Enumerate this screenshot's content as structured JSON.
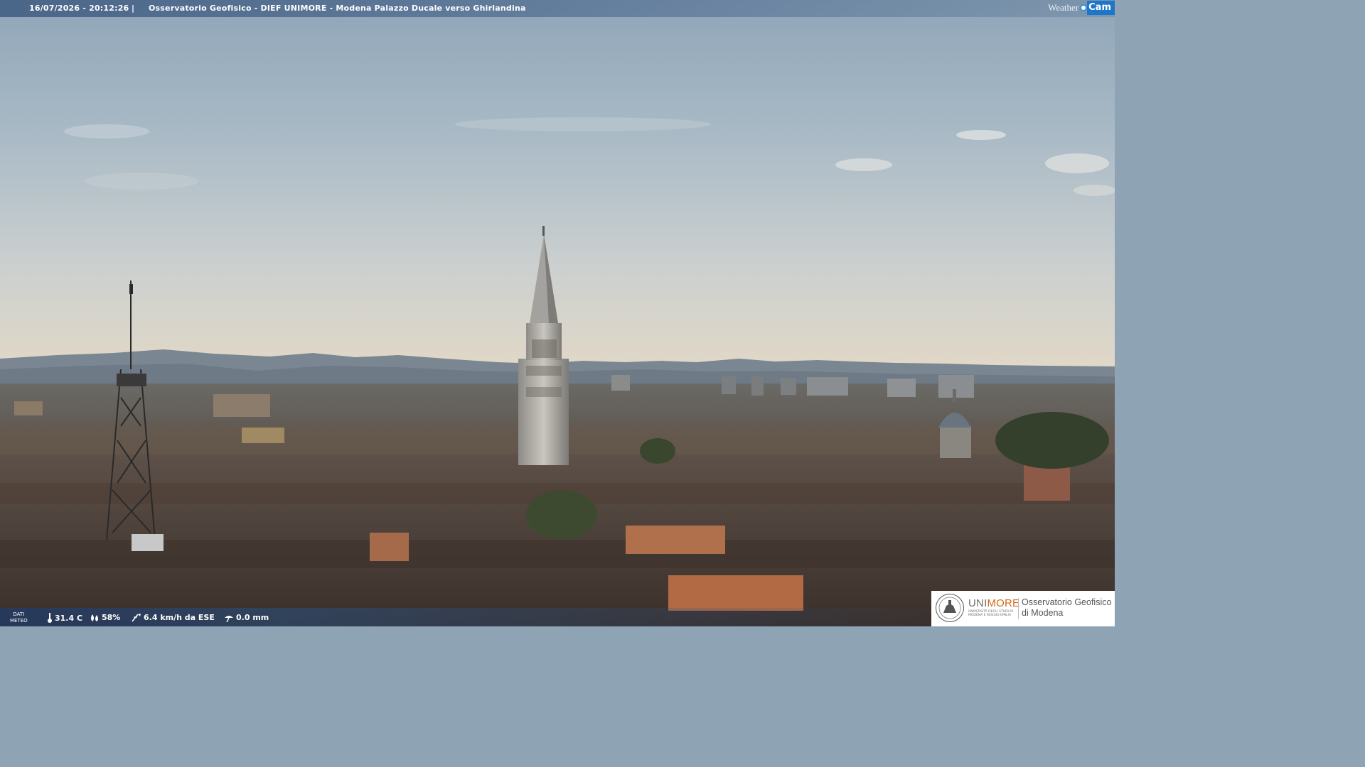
{
  "overlay": {
    "timestamp": "16/07/2026 - 20:12:26",
    "separator": "|",
    "title": "Osservatorio Geofisico - DIEF UNIMORE - Modena Palazzo Ducale verso Ghirlandina"
  },
  "brand": {
    "weather_text": "Weather",
    "cam_text": "Cam",
    "accent_color": "#1f76c9"
  },
  "weather_data": {
    "label_line1": "DATI",
    "label_line2": "METEO",
    "temperature": "31.4 C",
    "humidity": "58%",
    "wind": "6.4 km/h da ESE",
    "rain": "0.0 mm",
    "icons": [
      "thermometer-icon",
      "humidity-drop-icon",
      "wind-icon",
      "rain-gauge-icon"
    ]
  },
  "logo": {
    "uni_part1": "UNI",
    "uni_part2": "MORE",
    "uni_color_accent": "#d2691e",
    "uni_sub_line1": "UNIVERSITÀ DEGLI STUDI DI",
    "uni_sub_line2": "MODENA E REGGIO EMILIA",
    "obs_line1": "Osservatorio Geofisico",
    "obs_line2": "di Modena"
  },
  "scene": {
    "description_colors": {
      "sky_top": "#8ea6ba",
      "sky_horizon": "#e6d8c2",
      "mountains": "#6f7d8a",
      "roofs": "#5a4a3e"
    }
  }
}
